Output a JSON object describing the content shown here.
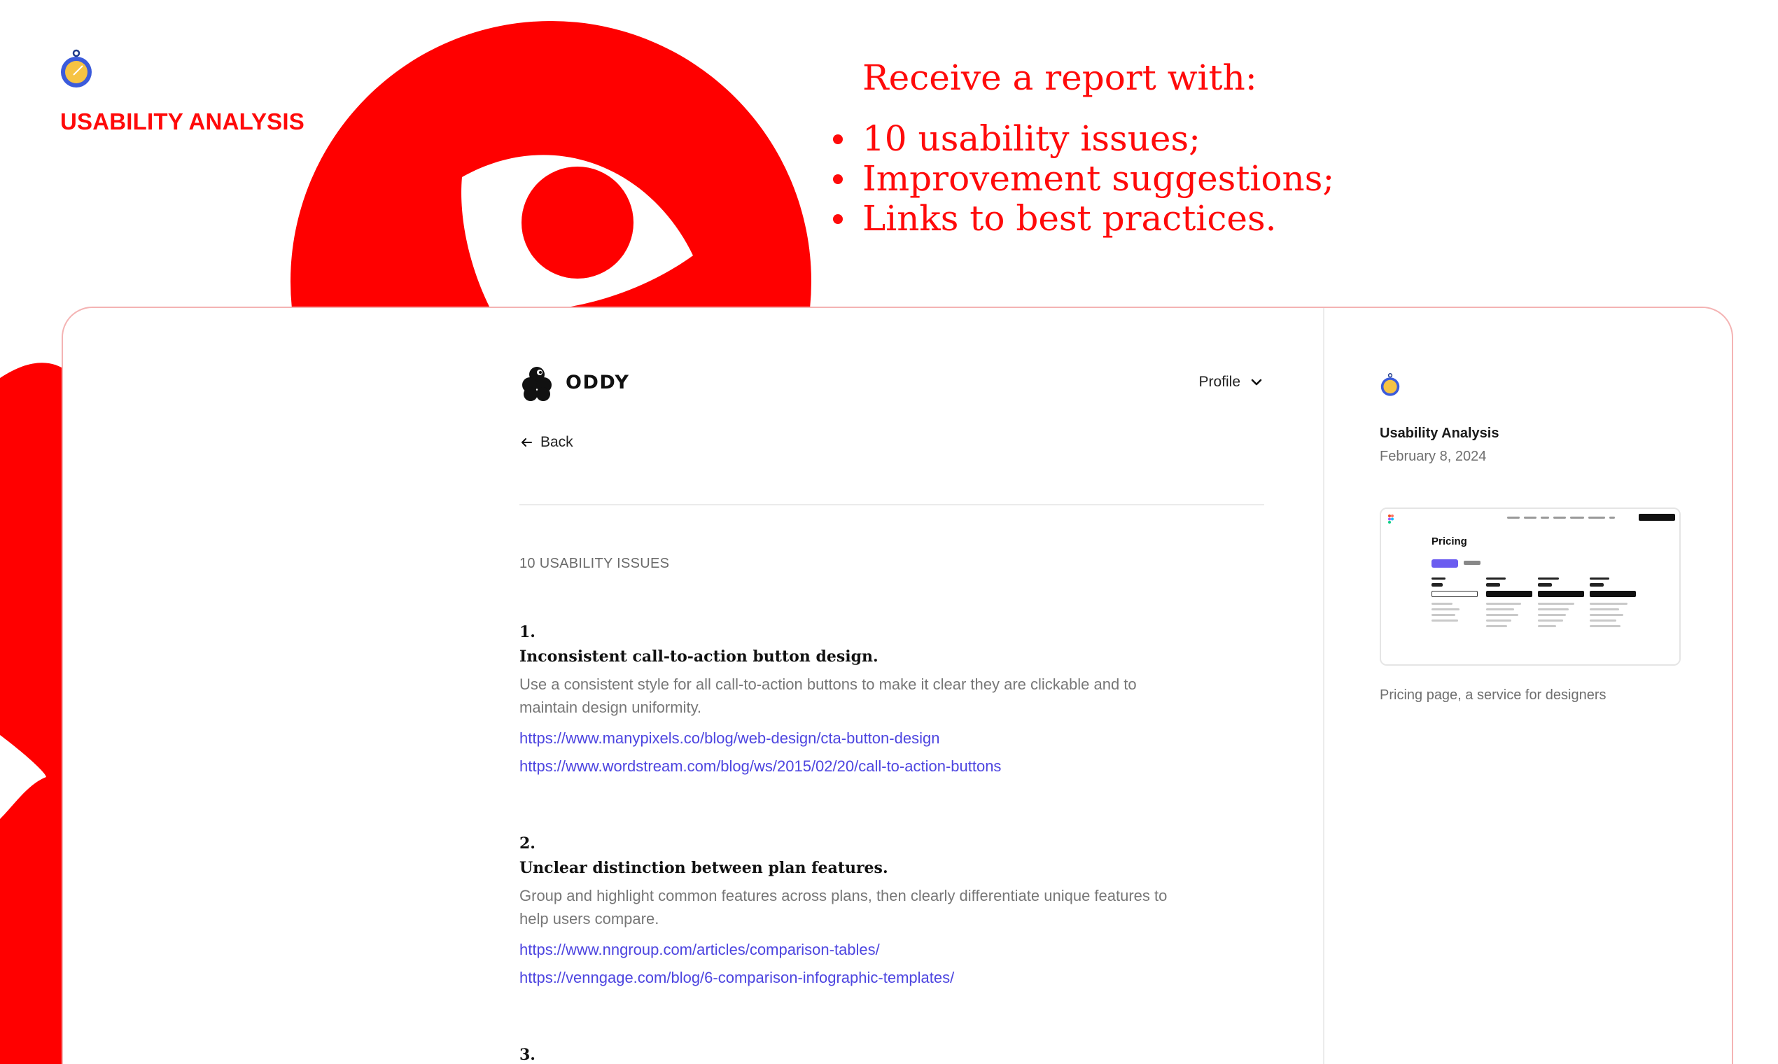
{
  "hero": {
    "brand_label": "USABILITY ANALYSIS",
    "promo_title": "Receive a report with:",
    "promo_points": [
      "10 usability issues;",
      "Improvement suggestions;",
      "Links to best practices."
    ],
    "accent_color": "#ff0a0a"
  },
  "app": {
    "logo_text": "ODDY",
    "profile_label": "Profile",
    "back_label": "Back",
    "section_label": "10 USABILITY ISSUES",
    "issues": [
      {
        "number": "1.",
        "title": "Inconsistent call-to-action button design.",
        "desc_lines": [
          "Use a consistent style for all call-to-action buttons to make it clear they are clickable and to",
          "maintain design uniformity."
        ],
        "links": [
          "https://www.manypixels.co/blog/web-design/cta-button-design",
          "https://www.wordstream.com/blog/ws/2015/02/20/call-to-action-buttons"
        ]
      },
      {
        "number": "2.",
        "title": "Unclear distinction between plan features.",
        "desc_lines": [
          "Group and highlight common features across plans, then clearly differentiate unique features to",
          "help users compare."
        ],
        "links": [
          "https://www.nngroup.com/articles/comparison-tables/",
          "https://venngage.com/blog/6-comparison-infographic-templates/"
        ]
      },
      {
        "number": "3."
      }
    ]
  },
  "sidebar": {
    "title": "Usability Analysis",
    "date": "February 8, 2024",
    "thumbnail_heading": "Pricing",
    "caption": "Pricing page, a service for designers"
  },
  "icons": {
    "brand": "compass-icon",
    "logo": "oddy-logo-icon",
    "profile": "chevron-down-icon",
    "back": "arrow-left-icon"
  }
}
